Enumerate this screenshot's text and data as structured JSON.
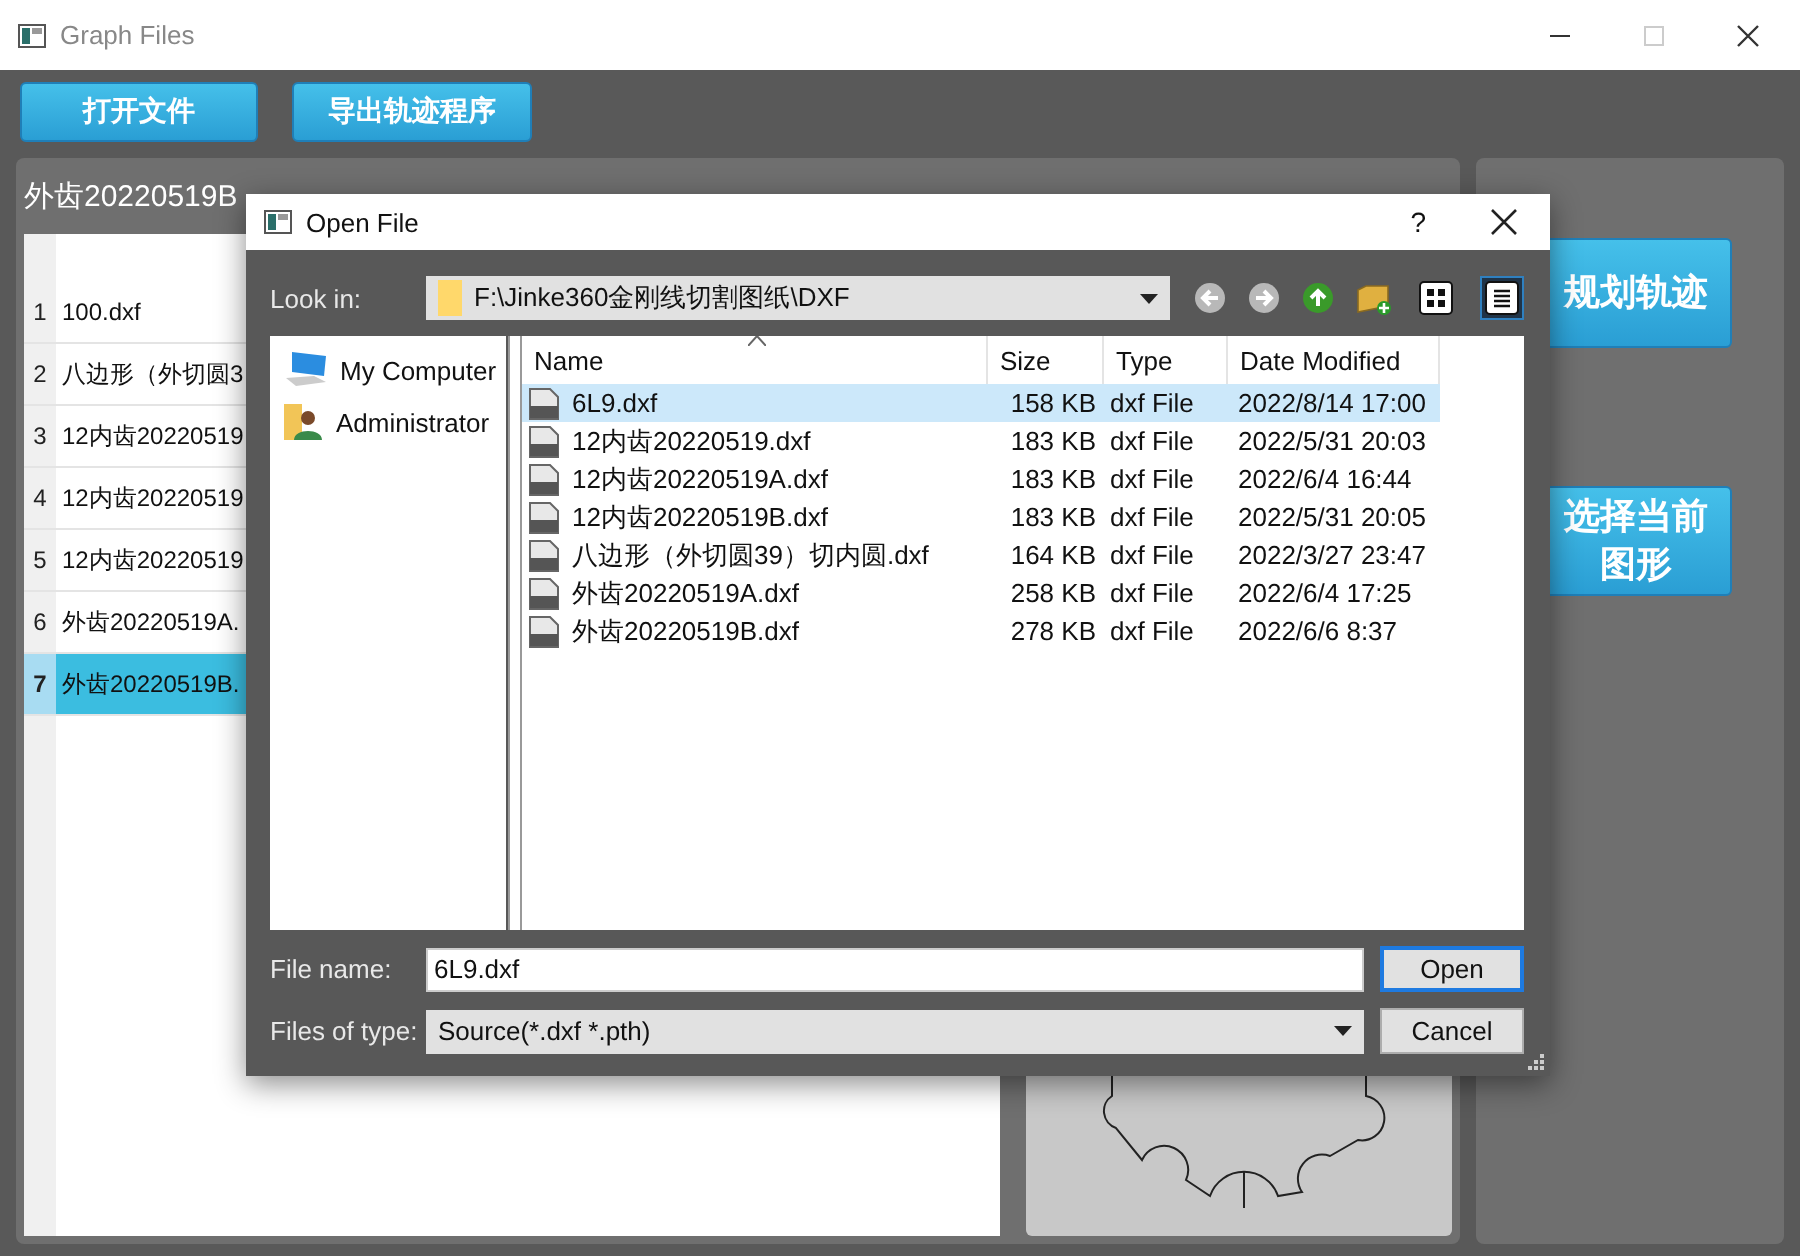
{
  "window": {
    "title": "Graph Files"
  },
  "toolbar": {
    "buttons": [
      "打开文件",
      "导出轨迹程序"
    ]
  },
  "file_panel": {
    "header": "外齿20220519B",
    "rows": [
      {
        "number": "1",
        "name": "100.dxf",
        "selected": false
      },
      {
        "number": "2",
        "name": "八边形（外切圆3",
        "selected": false
      },
      {
        "number": "3",
        "name": "12内齿20220519",
        "selected": false
      },
      {
        "number": "4",
        "name": "12内齿20220519",
        "selected": false
      },
      {
        "number": "5",
        "name": "12内齿20220519",
        "selected": false
      },
      {
        "number": "6",
        "name": "外齿20220519A.",
        "selected": false
      },
      {
        "number": "7",
        "name": "外齿20220519B.",
        "selected": true
      }
    ]
  },
  "side_buttons": [
    "规划轨迹",
    "选择当前图形"
  ],
  "dialog": {
    "title": "Open File",
    "help": "?",
    "look_in": {
      "label": "Look in:",
      "value": "F:\\Jinke360金刚线切割图纸\\DXF"
    },
    "view_modes": [
      {
        "kind": "icons",
        "selected": false
      },
      {
        "kind": "detail",
        "selected": true
      }
    ],
    "places": [
      {
        "name": "My Computer",
        "kind": "computer"
      },
      {
        "name": "Administrator",
        "kind": "user"
      }
    ],
    "columns": [
      "Name",
      "Size",
      "Type",
      "Date Modified"
    ],
    "files": [
      {
        "name": "6L9.dxf",
        "size": "158 KB",
        "type": "dxf File",
        "modified": "2022/8/14 17:00",
        "selected": true
      },
      {
        "name": "12内齿20220519.dxf",
        "size": "183 KB",
        "type": "dxf File",
        "modified": "2022/5/31 20:03",
        "selected": false
      },
      {
        "name": "12内齿20220519A.dxf",
        "size": "183 KB",
        "type": "dxf File",
        "modified": "2022/6/4 16:44",
        "selected": false
      },
      {
        "name": "12内齿20220519B.dxf",
        "size": "183 KB",
        "type": "dxf File",
        "modified": "2022/5/31 20:05",
        "selected": false
      },
      {
        "name": "八边形（外切圆39）切内圆.dxf",
        "size": "164 KB",
        "type": "dxf File",
        "modified": "2022/3/27 23:47",
        "selected": false
      },
      {
        "name": "外齿20220519A.dxf",
        "size": "258 KB",
        "type": "dxf File",
        "modified": "2022/6/4 17:25",
        "selected": false
      },
      {
        "name": "外齿20220519B.dxf",
        "size": "278 KB",
        "type": "dxf File",
        "modified": "2022/6/6 8:37",
        "selected": false
      }
    ],
    "file_name": {
      "label": "File name:",
      "value": "6L9.dxf"
    },
    "file_type": {
      "label": "Files of type:",
      "value": "Source(*.dxf *.pth)"
    },
    "buttons": [
      {
        "label": "Open",
        "default": true
      },
      {
        "label": "Cancel",
        "default": false
      }
    ]
  }
}
